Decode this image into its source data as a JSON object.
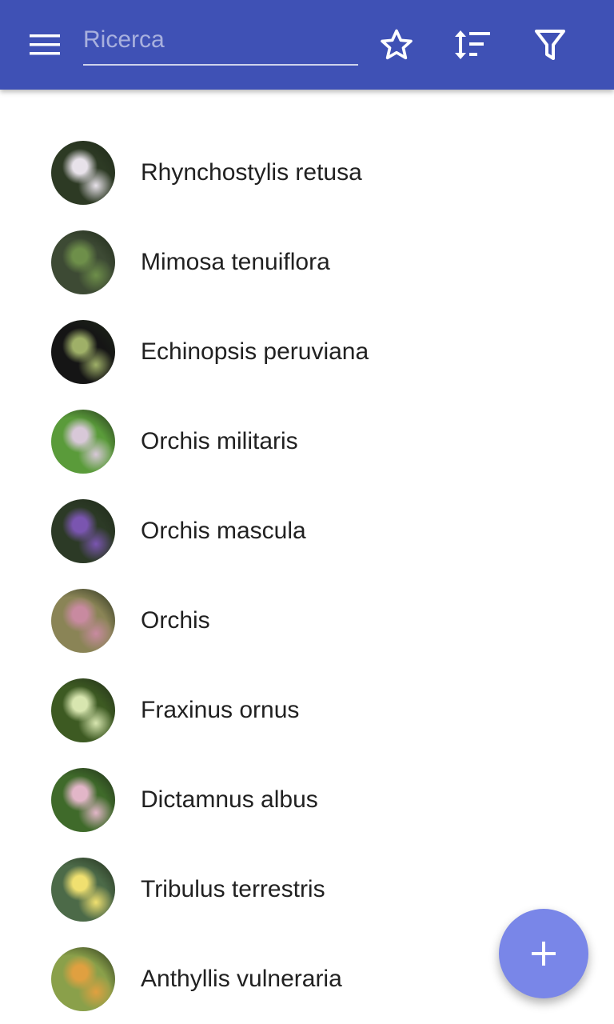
{
  "toolbar": {
    "menu_icon": "menu-icon",
    "search": {
      "placeholder": "Ricerca",
      "value": ""
    },
    "favorite_icon": "star-outline-icon",
    "sort_icon": "sort-icon",
    "filter_icon": "filter-icon"
  },
  "plants": [
    {
      "name": "Rhynchostylis retusa",
      "thumb_colors": [
        "#2d3a24",
        "#e8e2ea"
      ]
    },
    {
      "name": "Mimosa tenuiflora",
      "thumb_colors": [
        "#3d4a34",
        "#6e8f4a"
      ]
    },
    {
      "name": "Echinopsis peruviana",
      "thumb_colors": [
        "#151515",
        "#9fb068"
      ]
    },
    {
      "name": "Orchis militaris",
      "thumb_colors": [
        "#5a9b3a",
        "#d8c8d8"
      ]
    },
    {
      "name": "Orchis mascula",
      "thumb_colors": [
        "#2c3a26",
        "#7a55b0"
      ]
    },
    {
      "name": "Orchis",
      "thumb_colors": [
        "#8a8456",
        "#c88aa0"
      ]
    },
    {
      "name": "Fraxinus ornus",
      "thumb_colors": [
        "#3d5a22",
        "#d8e6b0"
      ]
    },
    {
      "name": "Dictamnus albus",
      "thumb_colors": [
        "#3f6a2a",
        "#e2b6c8"
      ]
    },
    {
      "name": "Tribulus terrestris",
      "thumb_colors": [
        "#4c6a48",
        "#f0e070"
      ]
    },
    {
      "name": "Anthyllis vulneraria",
      "thumb_colors": [
        "#8aa04a",
        "#e0a040"
      ]
    }
  ],
  "fab": {
    "icon": "plus-icon",
    "color": "#7986e8"
  },
  "colors": {
    "appbar": "#3f51b5",
    "text": "#212121"
  }
}
